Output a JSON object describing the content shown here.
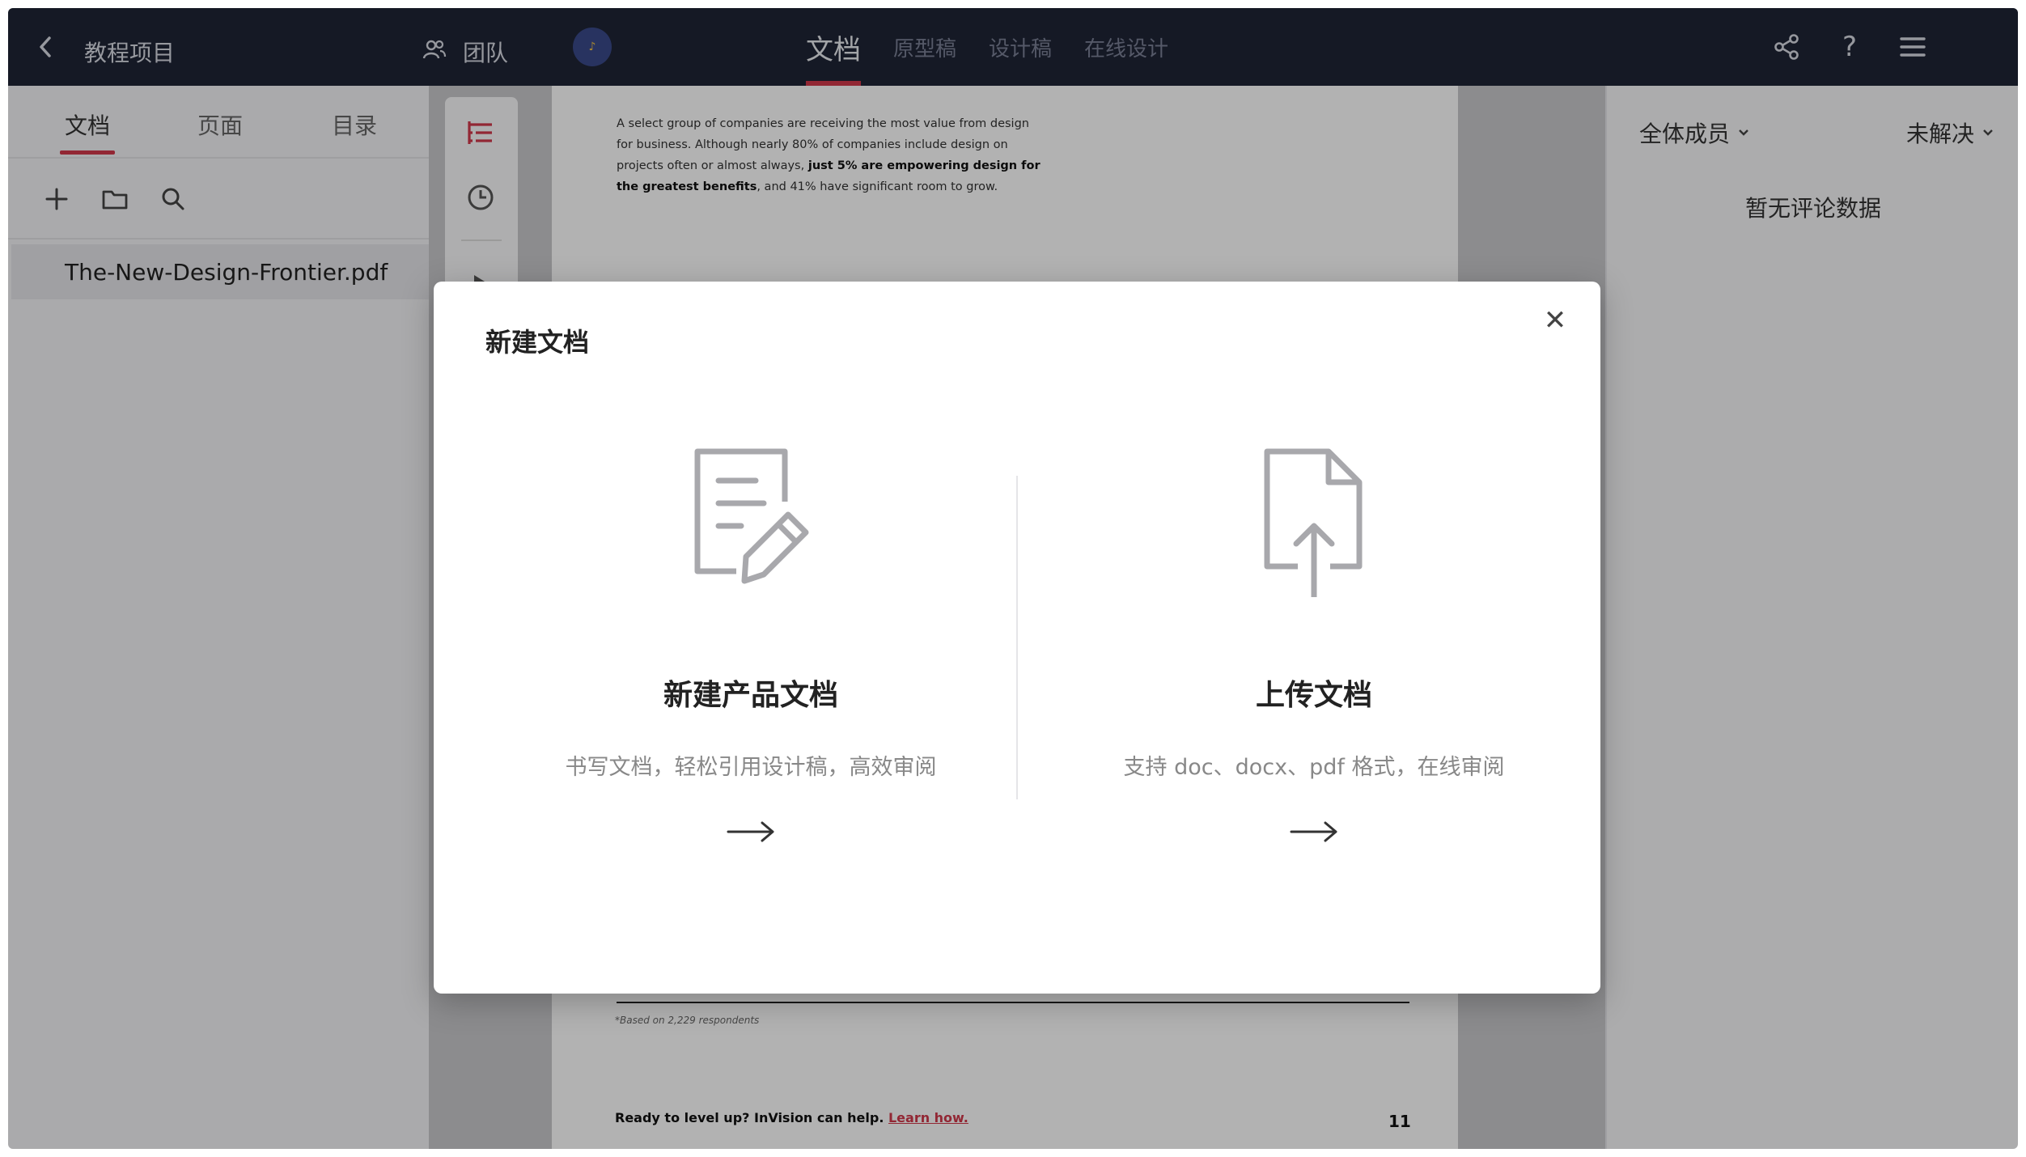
{
  "topbar": {
    "project_name": "教程项目",
    "team_label": "团队",
    "avatar_text": "♪",
    "tabs": [
      {
        "label": "文档",
        "active": true
      },
      {
        "label": "原型稿",
        "active": false
      },
      {
        "label": "设计稿",
        "active": false
      },
      {
        "label": "在线设计",
        "active": false
      }
    ],
    "icons": [
      "share-icon",
      "help-icon",
      "menu-icon"
    ],
    "help_glyph": "?"
  },
  "leftpanel": {
    "tabs": [
      "文档",
      "页面",
      "目录"
    ],
    "tools": [
      "plus-icon",
      "folder-icon",
      "search-icon"
    ],
    "file_name": "The-New-Design-Frontier.pdf"
  },
  "document": {
    "para_line1": "A select group of companies are receiving the most value from design",
    "para_line2": "for business. Although nearly 80% of companies include design on",
    "para_line3_a": "projects often or almost always, ",
    "para_line3_b": "just 5% are empowering design for",
    "para_line4_b": "the greatest benefits",
    "para_line4_c": ", and 41% have significant room to grow.",
    "footnote": "*Based on 2,229 respondents",
    "footer_text": "Ready to level up? InVision can help. ",
    "footer_link": "Learn how.",
    "page_number": "11"
  },
  "rightpanel": {
    "filter_members": "全体成员",
    "filter_status": "未解决",
    "empty_text": "暂无评论数据"
  },
  "modal": {
    "title": "新建文档",
    "close_glyph": "✕",
    "options": [
      {
        "title": "新建产品文档",
        "desc": "书写文档，轻松引用设计稿，高效审阅",
        "icon": "document-edit-icon"
      },
      {
        "title": "上传文档",
        "desc": "支持 doc、docx、pdf 格式，在线审阅",
        "icon": "document-upload-icon"
      }
    ]
  },
  "colors": {
    "topbar_bg": "#1f2435",
    "accent": "#d2384b"
  }
}
